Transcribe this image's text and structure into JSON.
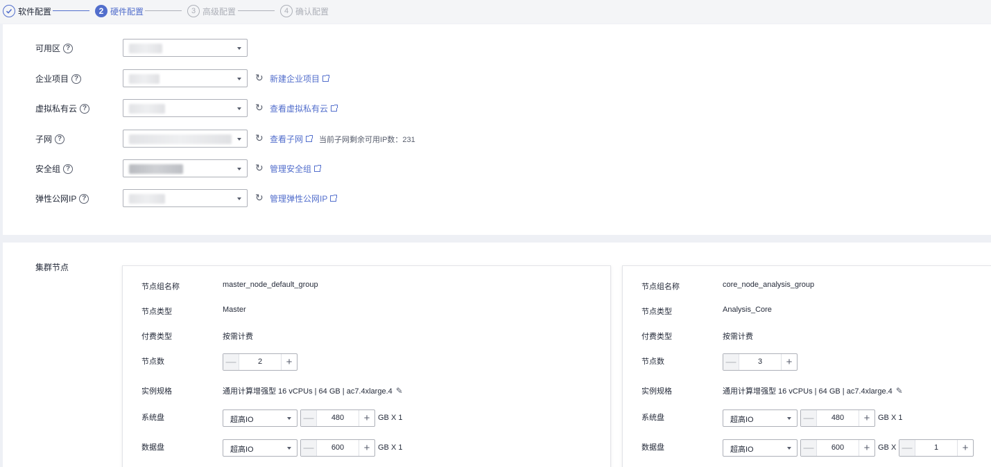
{
  "steps": [
    {
      "index": "✓",
      "label": "软件配置",
      "state": "done"
    },
    {
      "index": "2",
      "label": "硬件配置",
      "state": "active"
    },
    {
      "index": "3",
      "label": "高级配置",
      "state": "todo"
    },
    {
      "index": "4",
      "label": "确认配置",
      "state": "todo"
    }
  ],
  "network": {
    "az": {
      "label": "可用区"
    },
    "project": {
      "label": "企业项目",
      "link": "新建企业项目"
    },
    "vpc": {
      "label": "虚拟私有云",
      "link": "查看虚拟私有云"
    },
    "subnet": {
      "label": "子网",
      "link": "查看子网",
      "hint": "当前子网剩余可用IP数：231"
    },
    "sg": {
      "label": "安全组",
      "link": "管理安全组"
    },
    "eip": {
      "label": "弹性公网IP",
      "link": "管理弹性公网IP"
    }
  },
  "cluster": {
    "title": "集群节点",
    "labels": {
      "group_name": "节点组名称",
      "node_type": "节点类型",
      "billing": "付费类型",
      "node_count": "节点数",
      "flavor": "实例规格",
      "sys_disk": "系统盘",
      "data_disk": "数据盘"
    },
    "unit_x1": "GB X 1",
    "unit_x": "GB X",
    "groups": [
      {
        "name": "master_node_default_group",
        "type": "Master",
        "billing": "按需计费",
        "count": "2",
        "flavor": "通用计算增强型 16 vCPUs | 64 GB | ac7.4xlarge.4",
        "sys_disk_type": "超高IO",
        "sys_disk_size": "480",
        "data_disk_type": "超高IO",
        "data_disk_size": "600"
      },
      {
        "name": "core_node_analysis_group",
        "type": "Analysis_Core",
        "billing": "按需计费",
        "count": "3",
        "flavor": "通用计算增强型 16 vCPUs | 64 GB | ac7.4xlarge.4",
        "sys_disk_type": "超高IO",
        "sys_disk_size": "480",
        "data_disk_type": "超高IO",
        "data_disk_size": "600",
        "data_disk_count": "1"
      }
    ]
  },
  "colors": {
    "accent": "#526ecc",
    "text": "#252b3a",
    "muted": "#adb0b8"
  }
}
